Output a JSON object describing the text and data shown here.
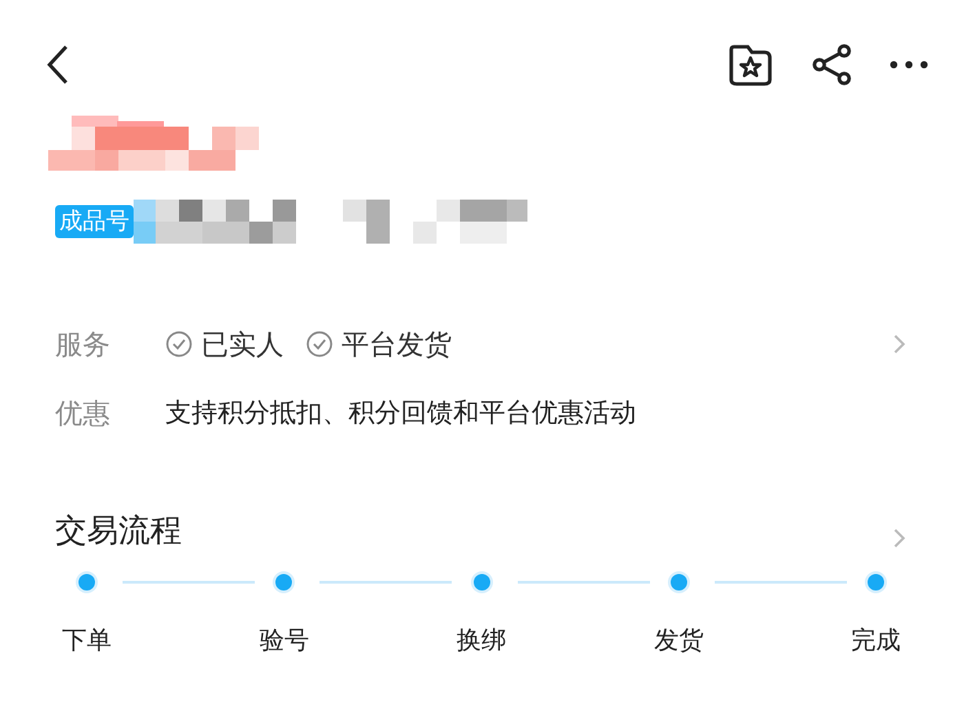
{
  "header": {
    "code_tag": "成品号"
  },
  "service": {
    "label": "服务",
    "items": [
      "已实人",
      "平台发货"
    ]
  },
  "discount": {
    "label": "优惠",
    "text": "支持积分抵扣、积分回馈和平台优惠活动"
  },
  "process": {
    "title": "交易流程",
    "steps": [
      "下单",
      "验号",
      "换绑",
      "发货",
      "完成"
    ]
  }
}
